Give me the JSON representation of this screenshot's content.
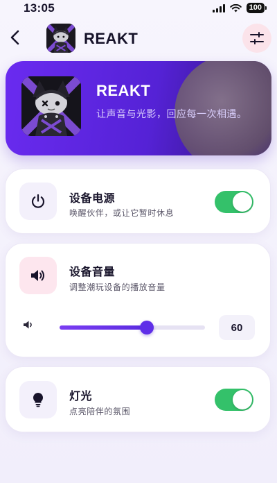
{
  "status_bar": {
    "time": "13:05",
    "battery": "100"
  },
  "header": {
    "title": "REAKT"
  },
  "hero": {
    "title": "REAKT",
    "subtitle": "让声音与光影，回应每一次相遇。"
  },
  "power_card": {
    "title": "设备电源",
    "subtitle": "唤醒伙伴，或让它暂时休息",
    "on": true
  },
  "volume_card": {
    "title": "设备音量",
    "subtitle": "调整潮玩设备的播放音量",
    "value": "60",
    "level_percent": 60
  },
  "light_card": {
    "title": "灯光",
    "subtitle": "点亮陪伴的氛围",
    "on": true
  },
  "colors": {
    "accent": "#5f2fe8",
    "toggle_on": "#34c16a",
    "hero_start": "#6a2bf0",
    "hero_end": "#2d1276"
  },
  "icons": {
    "back": "chevron-left-icon",
    "settings": "sliders-icon",
    "power": "power-icon",
    "volume": "speaker-icon",
    "volume_small": "speaker-small-icon",
    "light": "bulb-icon"
  }
}
